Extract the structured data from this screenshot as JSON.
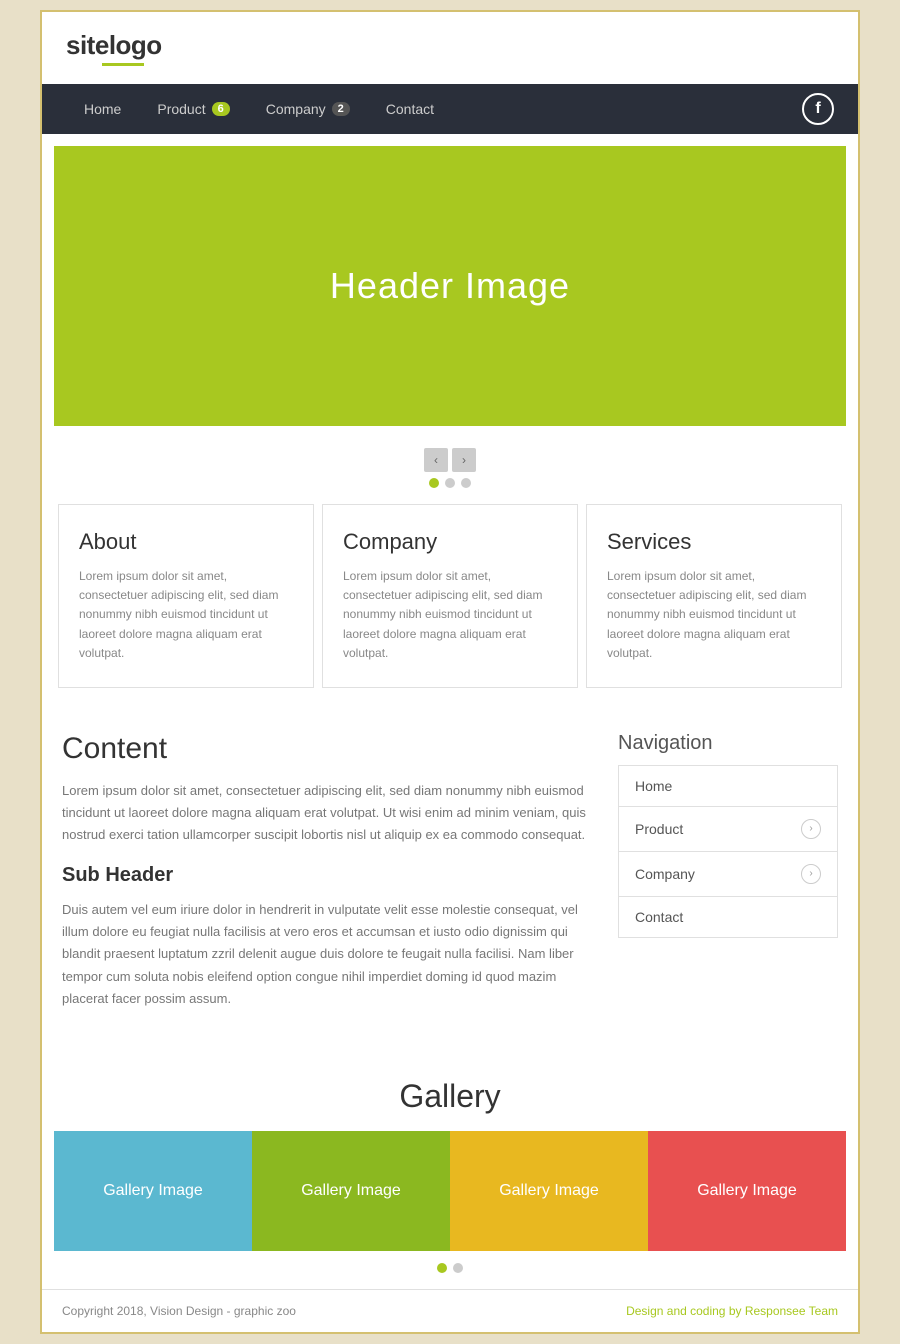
{
  "site": {
    "logo": "sitelogo",
    "logo_site": "site",
    "logo_name": "logo"
  },
  "nav": {
    "items": [
      {
        "label": "Home",
        "badge": null
      },
      {
        "label": "Product",
        "badge": "6"
      },
      {
        "label": "Company",
        "badge": "2"
      },
      {
        "label": "Contact",
        "badge": null
      }
    ],
    "facebook_icon": "f"
  },
  "hero": {
    "text": "Header Image"
  },
  "slider": {
    "prev": "‹",
    "next": "›"
  },
  "cards": [
    {
      "title": "About",
      "text": "Lorem ipsum dolor sit amet, consectetuer adipiscing elit, sed diam nonummy nibh euismod tincidunt ut laoreet dolore magna aliquam erat volutpat."
    },
    {
      "title": "Company",
      "text": "Lorem ipsum dolor sit amet, consectetuer adipiscing elit, sed diam nonummy nibh euismod tincidunt ut laoreet dolore magna aliquam erat volutpat."
    },
    {
      "title": "Services",
      "text": "Lorem ipsum dolor sit amet, consectetuer adipiscing elit, sed diam nonummy nibh euismod tincidunt ut laoreet dolore magna aliquam erat volutpat."
    }
  ],
  "content": {
    "title": "Content",
    "main_text": "Lorem ipsum dolor sit amet, consectetuer adipiscing elit, sed diam nonummy nibh euismod tincidunt ut laoreet dolore magna aliquam erat volutpat. Ut wisi enim ad minim veniam, quis nostrud exerci tation ullamcorper suscipit lobortis nisl ut aliquip ex ea commodo consequat.",
    "sub_header": "Sub Header",
    "sub_text": "Duis autem vel eum iriure dolor in hendrerit in vulputate velit esse molestie consequat, vel illum dolore eu feugiat nulla facilisis at vero eros et accumsan et iusto odio dignissim qui blandit praesent luptatum zzril delenit augue duis dolore te feugait nulla facilisi. Nam liber tempor cum soluta nobis eleifend option congue nihil imperdiet doming id quod mazim placerat facer possim assum."
  },
  "sidebar_nav": {
    "title": "Navigation",
    "items": [
      {
        "label": "Home",
        "has_arrow": false
      },
      {
        "label": "Product",
        "has_arrow": true
      },
      {
        "label": "Company",
        "has_arrow": true
      },
      {
        "label": "Contact",
        "has_arrow": false
      }
    ]
  },
  "gallery": {
    "title": "Gallery",
    "items": [
      "Gallery Image",
      "Gallery Image",
      "Gallery Image",
      "Gallery Image"
    ]
  },
  "footer": {
    "copy": "Copyright 2018, Vision Design - graphic zoo",
    "credit": "Design and coding by Responsee Team"
  }
}
